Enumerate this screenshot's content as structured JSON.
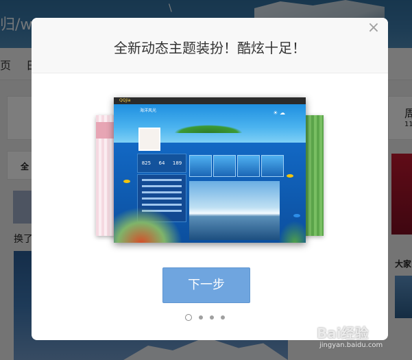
{
  "background": {
    "logo_text": "归/w",
    "tick_text": "\\",
    "nav_items": [
      "页",
      "日"
    ],
    "right_text_1": "周",
    "right_text_2": "11",
    "left_tab_text": "全",
    "left_post_text": "换了",
    "right_section_text": "大家"
  },
  "modal": {
    "title": "全新动态主题装扮！酷炫十足！",
    "close_symbol": "×",
    "next_button_label": "下一步",
    "dots_total": 4,
    "dots_active_index": 0,
    "preview": {
      "topbar_text": "QQjia",
      "space_name": "海洋风光",
      "stats": [
        "825",
        "64",
        "189"
      ]
    }
  },
  "watermark": {
    "main": "Bai经验",
    "sub": "jingyan.baidu.com"
  },
  "colors": {
    "overlay": "#000000",
    "button": "#6fa5df",
    "title": "#333333"
  }
}
